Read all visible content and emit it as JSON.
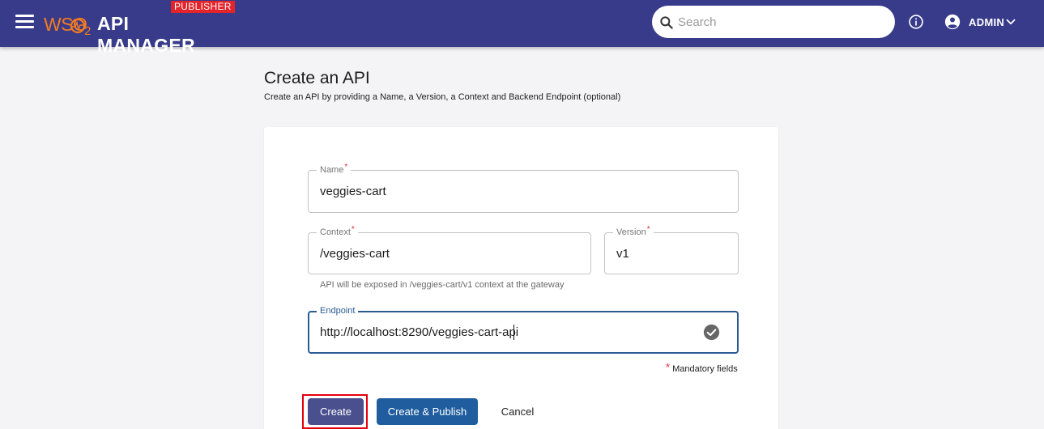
{
  "header": {
    "logo_brand": "WSO",
    "logo_brand_sub": "2",
    "logo_product": "API MANAGER",
    "publisher_badge": "PUBLISHER",
    "search_placeholder": "Search",
    "user_name": "ADMIN"
  },
  "page": {
    "title": "Create an API",
    "subtitle": "Create an API by providing a Name, a Version, a Context and Backend Endpoint (optional)"
  },
  "form": {
    "name": {
      "label": "Name",
      "value": "veggies-cart"
    },
    "context": {
      "label": "Context",
      "value": "/veggies-cart"
    },
    "version": {
      "label": "Version",
      "value": "v1"
    },
    "context_helper": "API will be exposed in /veggies-cart/v1 context at the gateway",
    "endpoint": {
      "label": "Endpoint",
      "value": "http://localhost:8290/veggies-cart-api"
    },
    "required_mark": "*",
    "mandatory_note": "Mandatory fields"
  },
  "actions": {
    "create": "Create",
    "create_publish": "Create & Publish",
    "cancel": "Cancel"
  },
  "colors": {
    "header_bg": "#373b8a",
    "brand_orange": "#f47b20",
    "badge_red": "#e3252b",
    "focus_blue": "#2b5b94",
    "create_btn": "#4a4f8e",
    "publish_btn": "#1f5d9e"
  }
}
